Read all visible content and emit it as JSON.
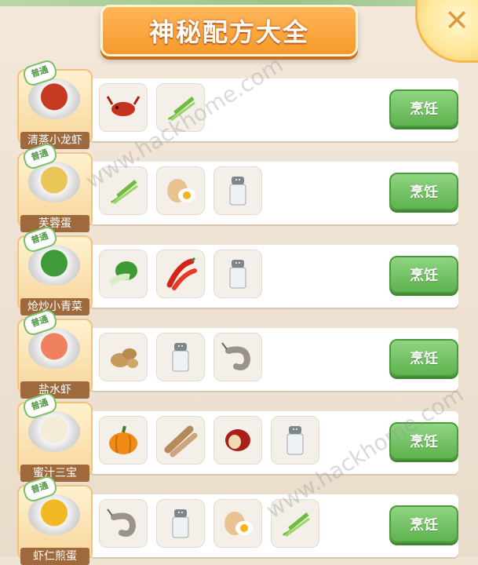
{
  "header": {
    "title": "神秘配方大全",
    "close_symbol": "✕"
  },
  "tag_label": "普通",
  "cook_label": "烹饪",
  "recipes": [
    {
      "name": "清蒸小龙虾",
      "food_color": "#c63a24",
      "ingredients": [
        "crayfish-icon",
        "green-onion-icon"
      ]
    },
    {
      "name": "芙蓉蛋",
      "food_color": "#e9c657",
      "ingredients": [
        "green-onion-icon",
        "egg-icon",
        "salt-shaker-icon"
      ]
    },
    {
      "name": "炝炒小青菜",
      "food_color": "#3f9b3a",
      "ingredients": [
        "bok-choy-icon",
        "chili-pepper-icon",
        "salt-shaker-icon"
      ]
    },
    {
      "name": "盐水虾",
      "food_color": "#f0815f",
      "ingredients": [
        "ginger-icon",
        "salt-shaker-icon",
        "shrimp-icon"
      ]
    },
    {
      "name": "蜜汁三宝",
      "food_color": "#f2ecd8",
      "ingredients": [
        "pumpkin-icon",
        "yam-icon",
        "red-date-icon",
        "salt-shaker-icon"
      ]
    },
    {
      "name": "虾仁煎蛋",
      "food_color": "#f2b825",
      "ingredients": [
        "shrimp-icon",
        "salt-shaker-icon",
        "egg-icon",
        "green-onion-icon"
      ]
    }
  ],
  "watermark": "www.hackhome.com"
}
